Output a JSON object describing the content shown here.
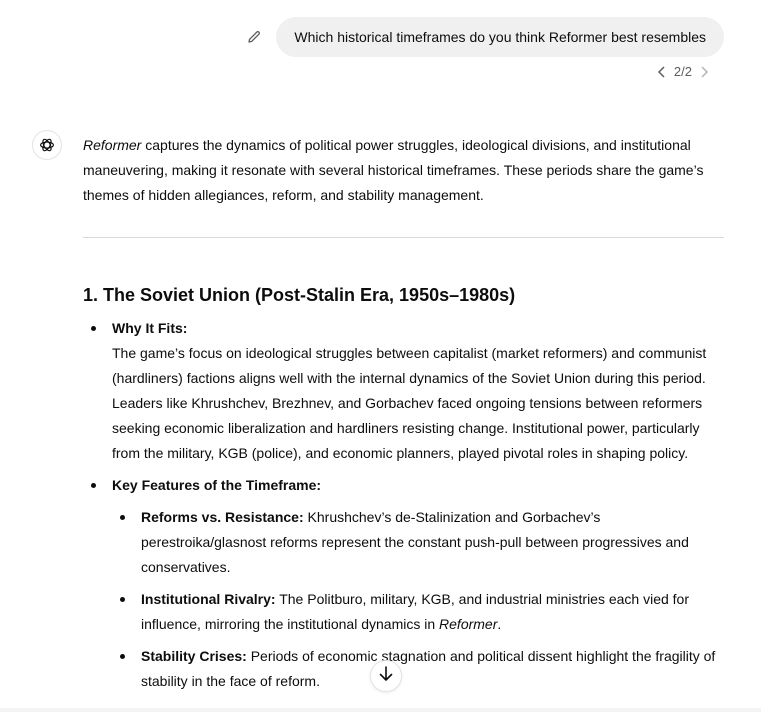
{
  "user_message": {
    "text": "Which historical timeframes do you think Reformer best resembles",
    "edit_icon": "pencil-icon"
  },
  "pager": {
    "label": "2/2",
    "prev_icon": "chevron-left-icon",
    "next_icon": "chevron-right-icon"
  },
  "assistant": {
    "avatar_icon": "openai-logo-icon",
    "intro_title": "Reformer",
    "intro_rest": " captures the dynamics of political power struggles, ideological divisions, and institutional maneuvering, making it resonate with several historical timeframes. These periods share the game’s themes of hidden allegiances, reform, and stability management.",
    "section1": {
      "title": "1. The Soviet Union (Post-Stalin Era, 1950s–1980s)",
      "why_label": "Why It Fits:",
      "why_text": "The game’s focus on ideological struggles between capitalist (market reformers) and communist (hardliners) factions aligns well with the internal dynamics of the Soviet Union during this period. Leaders like Khrushchev, Brezhnev, and Gorbachev faced ongoing tensions between reformers seeking economic liberalization and hardliners resisting change. Institutional power, particularly from the military, KGB (police), and economic planners, played pivotal roles in shaping policy.",
      "features_label": "Key Features of the Timeframe:",
      "features": [
        {
          "label": "Reforms vs. Resistance:",
          "text": " Khrushchev’s de-Stalinization and Gorbachev’s perestroika/glasnost reforms represent the constant push-pull between progressives and conservatives."
        },
        {
          "label": "Institutional Rivalry:",
          "text": " The Politburo, military, KGB, and industrial ministries each vied for influence, mirroring the institutional dynamics in ",
          "em": "Reformer",
          "tail": "."
        },
        {
          "label": "Stability Crises:",
          "text": " Periods of economic stagnation and political dissent highlight the fragility of stability in the face of reform."
        }
      ]
    }
  },
  "scroll_button": {
    "icon": "arrow-down-icon"
  }
}
